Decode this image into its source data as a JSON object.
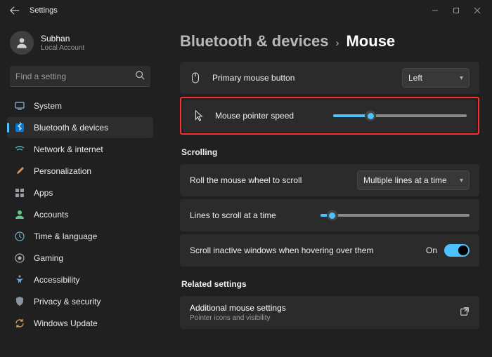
{
  "titlebar": {
    "title": "Settings"
  },
  "profile": {
    "name": "Subhan",
    "account_type": "Local Account"
  },
  "search": {
    "placeholder": "Find a setting"
  },
  "sidebar": {
    "items": [
      {
        "label": "System"
      },
      {
        "label": "Bluetooth & devices"
      },
      {
        "label": "Network & internet"
      },
      {
        "label": "Personalization"
      },
      {
        "label": "Apps"
      },
      {
        "label": "Accounts"
      },
      {
        "label": "Time & language"
      },
      {
        "label": "Gaming"
      },
      {
        "label": "Accessibility"
      },
      {
        "label": "Privacy & security"
      },
      {
        "label": "Windows Update"
      }
    ]
  },
  "breadcrumb": {
    "parent": "Bluetooth & devices",
    "current": "Mouse"
  },
  "settings": {
    "primary_button": {
      "label": "Primary mouse button",
      "value": "Left"
    },
    "pointer_speed": {
      "label": "Mouse pointer speed",
      "percent": 28
    },
    "scrolling_header": "Scrolling",
    "scroll_mode": {
      "label": "Roll the mouse wheel to scroll",
      "value": "Multiple lines at a time"
    },
    "lines_scroll": {
      "label": "Lines to scroll at a time",
      "percent": 8
    },
    "scroll_inactive": {
      "label": "Scroll inactive windows when hovering over them",
      "value": "On"
    },
    "related_header": "Related settings",
    "additional": {
      "title": "Additional mouse settings",
      "subtitle": "Pointer icons and visibility"
    }
  }
}
